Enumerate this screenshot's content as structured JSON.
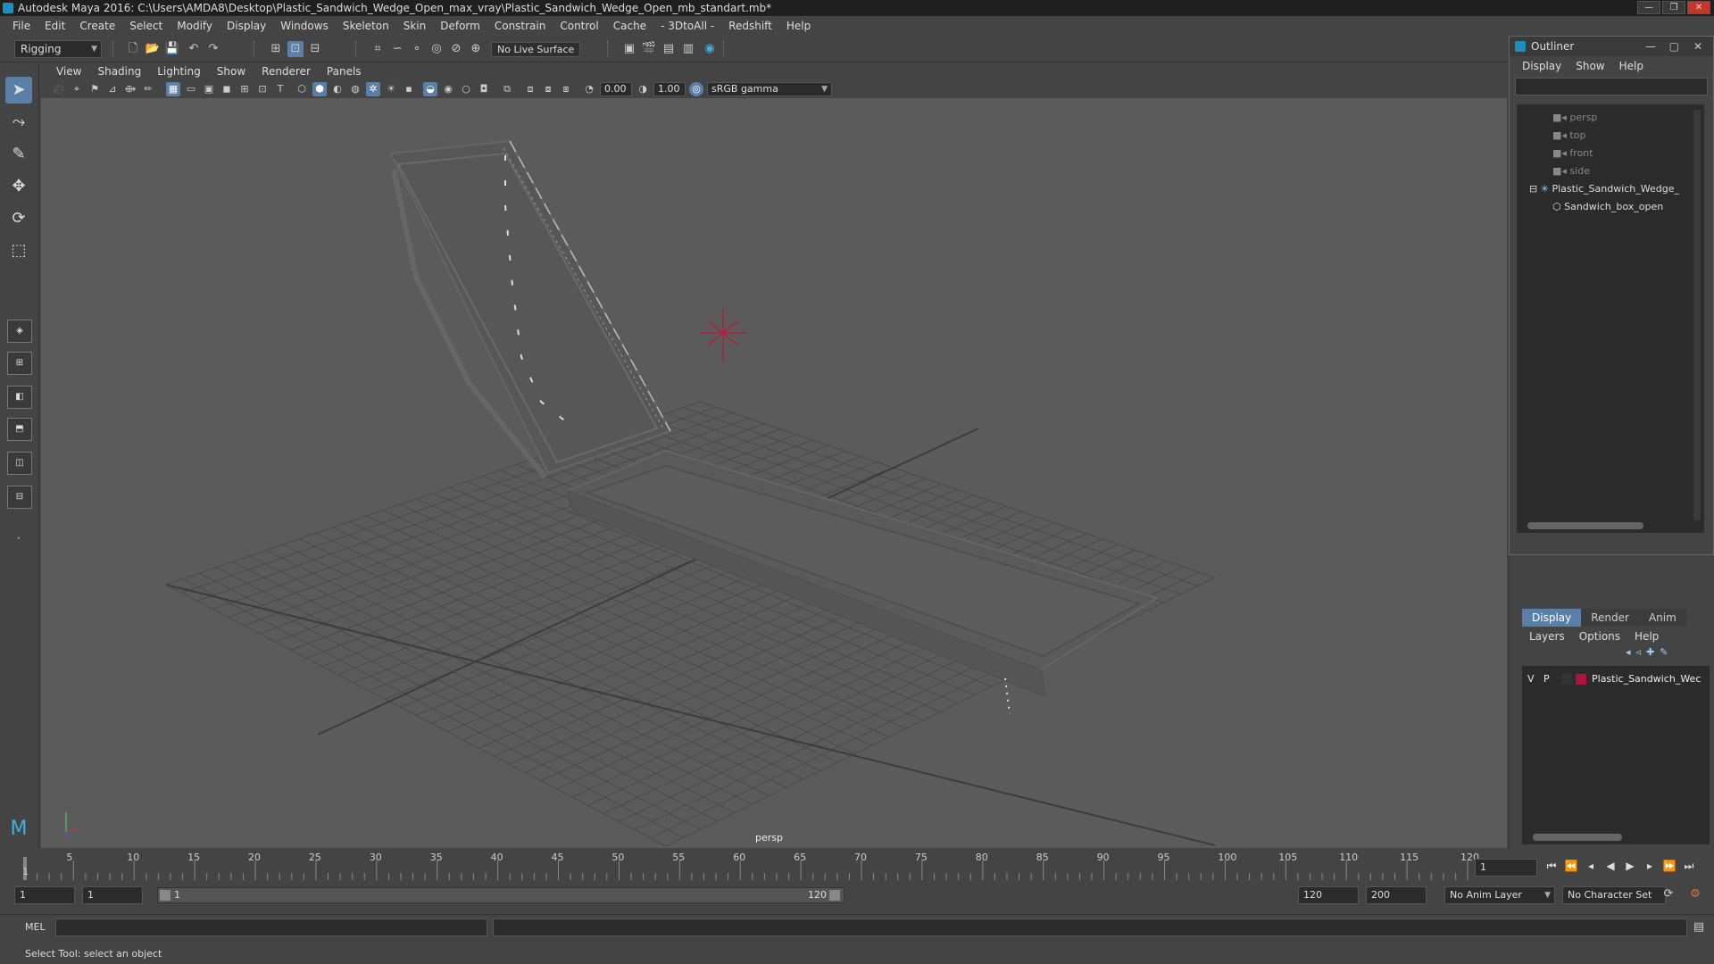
{
  "window": {
    "title": "Autodesk Maya 2016: C:\\Users\\AMDA8\\Desktop\\Plastic_Sandwich_Wedge_Open_max_vray\\Plastic_Sandwich_Wedge_Open_mb_standart.mb*"
  },
  "menubar": [
    "File",
    "Edit",
    "Create",
    "Select",
    "Modify",
    "Display",
    "Windows",
    "Skeleton",
    "Skin",
    "Deform",
    "Constrain",
    "Control",
    "Cache",
    "- 3DtoAll -",
    "Redshift",
    "Help"
  ],
  "shelf": {
    "mode": "Rigging",
    "live_surface": "No Live Surface"
  },
  "viewport": {
    "menus": [
      "View",
      "Shading",
      "Lighting",
      "Show",
      "Renderer",
      "Panels"
    ],
    "exposure": "0.00",
    "gamma": "1.00",
    "color_space": "sRGB gamma",
    "camera": "persp"
  },
  "outliner": {
    "title": "Outliner",
    "menus": [
      "Display",
      "Show",
      "Help"
    ],
    "items": [
      {
        "label": "persp",
        "kind": "camera"
      },
      {
        "label": "top",
        "kind": "camera"
      },
      {
        "label": "front",
        "kind": "camera"
      },
      {
        "label": "side",
        "kind": "camera"
      },
      {
        "label": "Plastic_Sandwich_Wedge_",
        "kind": "group"
      },
      {
        "label": "Sandwich_box_open",
        "kind": "mesh"
      }
    ]
  },
  "layers": {
    "tabs": [
      "Display",
      "Render",
      "Anim"
    ],
    "menus": [
      "Layers",
      "Options",
      "Help"
    ],
    "row": {
      "v": "V",
      "p": "P",
      "name": "Plastic_Sandwich_Wec",
      "color": "#b0143c"
    }
  },
  "timeline": {
    "ticks": [
      "5",
      "10",
      "15",
      "20",
      "25",
      "30",
      "35",
      "40",
      "45",
      "50",
      "55",
      "60",
      "65",
      "70",
      "75",
      "80",
      "85",
      "90",
      "95",
      "100",
      "105",
      "110",
      "115",
      "120"
    ],
    "first_tick": "1",
    "current_frame": "1"
  },
  "range": {
    "start": "1",
    "anim_start": "1",
    "slider_start": "1",
    "slider_end": "120",
    "anim_end": "120",
    "end": "200",
    "anim_layer": "No Anim Layer",
    "char_set": "No Character Set"
  },
  "cmdline": {
    "lang": "MEL"
  },
  "helpline": {
    "text": "Select Tool: select an object"
  },
  "colors": {
    "accent": "#5a7fa8",
    "layer_color": "#b0143c",
    "crosshair": "#b0203a"
  }
}
